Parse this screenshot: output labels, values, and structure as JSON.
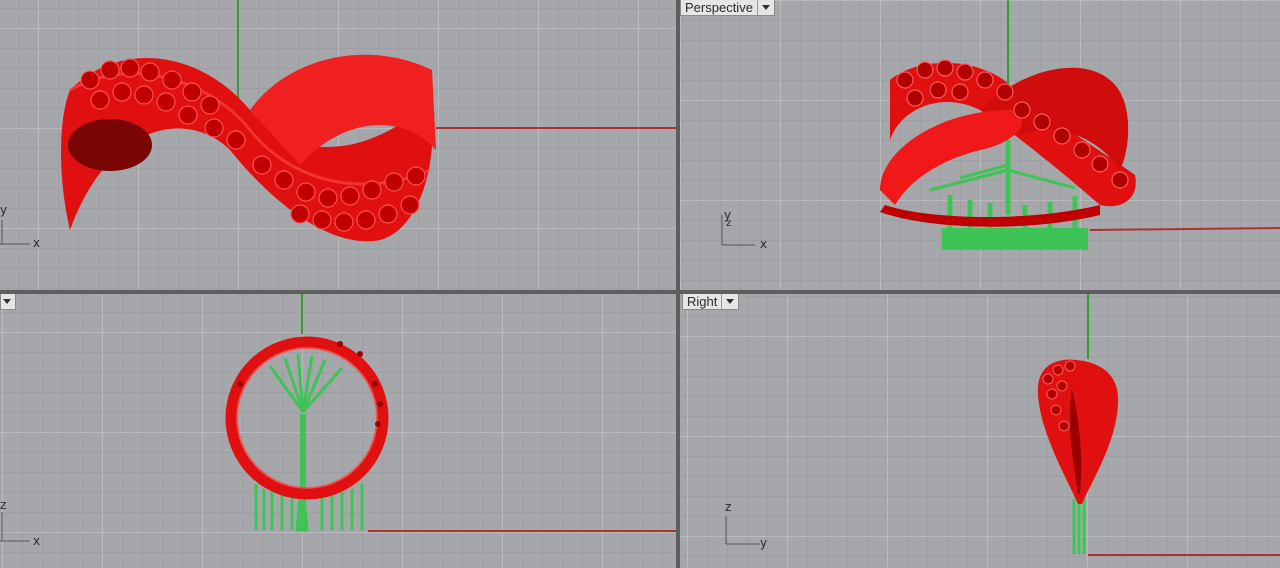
{
  "viewports": {
    "top": {
      "title": "",
      "axes": {
        "h": "x",
        "v": "y"
      }
    },
    "perspective": {
      "title": "Perspective",
      "axes": {
        "h": "x",
        "v": "y",
        "d": "z"
      }
    },
    "front": {
      "title": "",
      "axes": {
        "h": "x",
        "v": "z"
      }
    },
    "right": {
      "title": "Right",
      "axes": {
        "h": "y",
        "v": "z"
      }
    }
  },
  "colors": {
    "viewport_bg": "#a5a7aa",
    "grid_major": "#b9bbbe",
    "grid_minor": "#9d9fa2",
    "x_axis": "#b03030",
    "y_axis": "#2fa02f",
    "ring": "#e81212",
    "supports": "#3ec456"
  },
  "icons": {
    "viewport_menu": "chevron-down-icon"
  }
}
